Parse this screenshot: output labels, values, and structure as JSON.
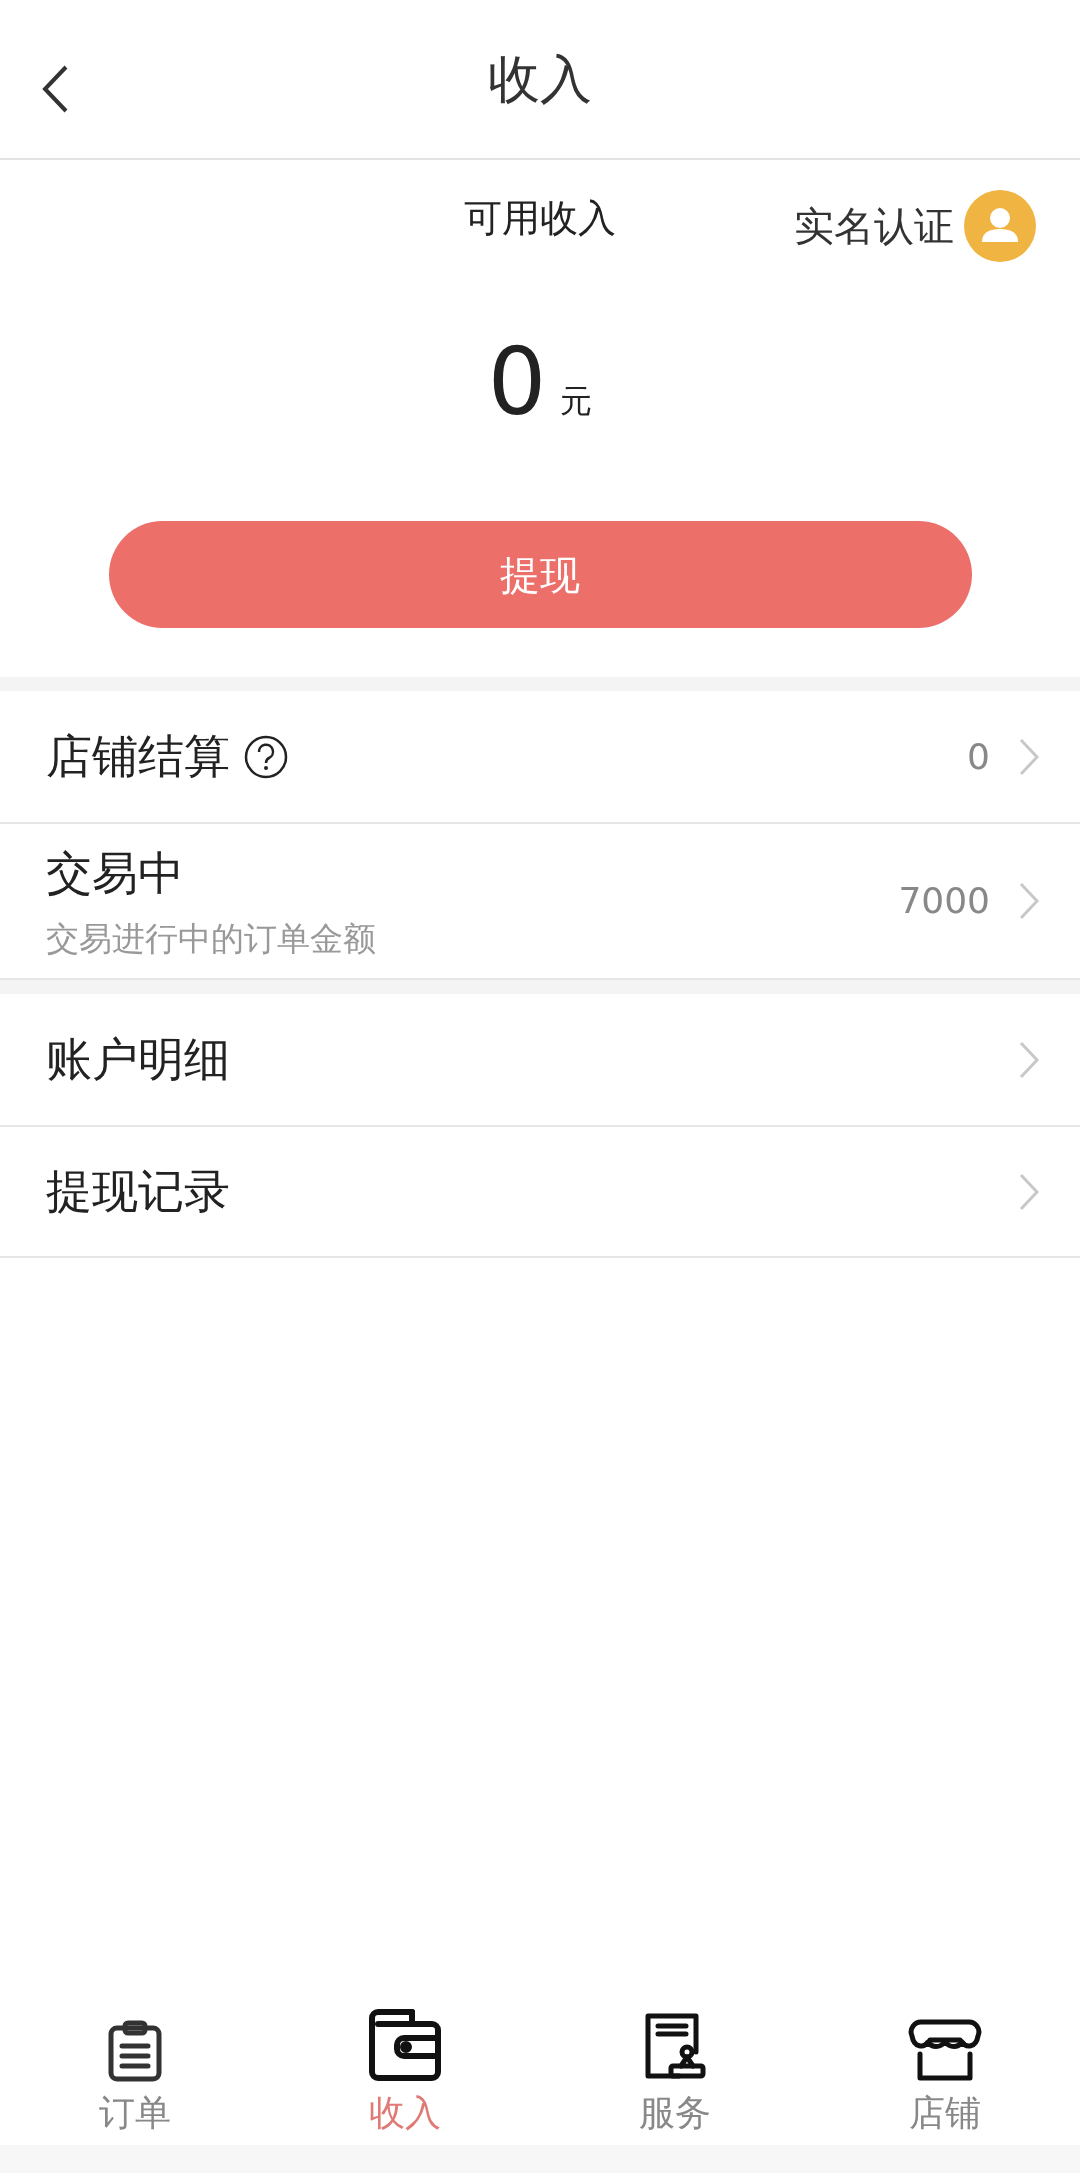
{
  "header": {
    "title": "收入"
  },
  "summary": {
    "label": "可用收入",
    "verify": "实名认证",
    "amount": "0",
    "unit": "元",
    "button": "提现"
  },
  "groups": [
    {
      "rows": [
        {
          "title": "店铺结算",
          "help": true,
          "value": "0"
        },
        {
          "title": "交易中",
          "subtitle": "交易进行中的订单金额",
          "help": false,
          "value": "7000"
        }
      ]
    },
    {
      "rows": [
        {
          "title": "账户明细",
          "help": false
        },
        {
          "title": "提现记录",
          "help": false
        }
      ]
    }
  ],
  "tabs": [
    {
      "kind": "clipboard",
      "label": "订单",
      "selected": false
    },
    {
      "kind": "wallet",
      "label": "收入",
      "selected": true
    },
    {
      "kind": "service",
      "label": "服务",
      "selected": false
    },
    {
      "kind": "store",
      "label": "店铺",
      "selected": false
    }
  ]
}
